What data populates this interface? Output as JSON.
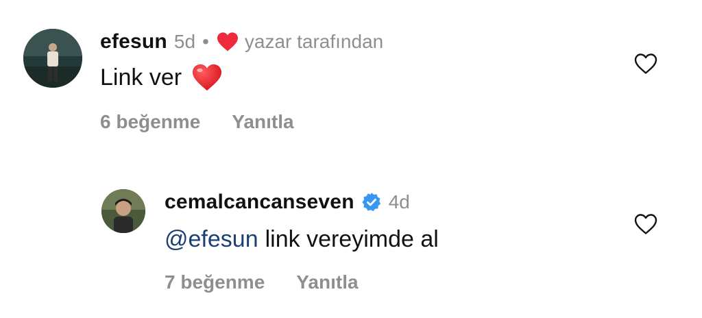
{
  "comments": [
    {
      "username": "efesun",
      "time": "5d",
      "separator": "•",
      "author_liked_label": "yazar tarafından",
      "text": "Link ver",
      "likes": "6 beğenme",
      "reply": "Yanıtla",
      "icons": {
        "author_like": "red-heart-icon",
        "emoji": "red-heart-emoji",
        "like": "heart-outline-icon"
      }
    },
    {
      "username": "cemalcancanseven",
      "time": "4d",
      "mention": "@efesun",
      "text": "link vereyimde al",
      "likes": "7 beğenme",
      "reply": "Yanıtla",
      "icons": {
        "verified": "verified-badge-icon",
        "like": "heart-outline-icon"
      }
    }
  ],
  "colors": {
    "muted": "#8e8e8e",
    "mention": "#1c3f74",
    "heart": "#ed2b3c",
    "verified": "#3897f0"
  }
}
